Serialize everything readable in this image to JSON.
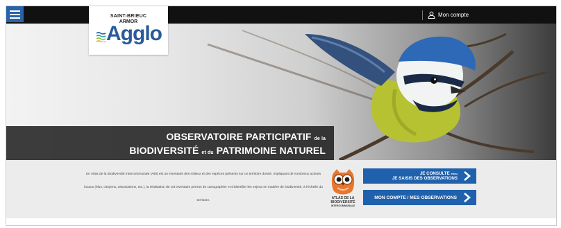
{
  "header": {
    "menu_icon": "hamburger-menu-icon",
    "account_label": "Mon compte",
    "account_icon": "user-icon",
    "background_color": "#111111",
    "menu_color": "#2a62a8"
  },
  "logo": {
    "line1": "SAINT-BRIEUC",
    "line2": "ARMOR",
    "wordmark": "Agglo",
    "tagline": "...",
    "brand_color": "#2b5a9a"
  },
  "hero": {
    "title_part1": "OBSERVATOIRE PARTICIPATIF",
    "title_connector1": "de la",
    "title_part2": "BIODIVERSITÉ",
    "title_connector2": "et du",
    "title_part3": "PATRIMOINE NATUREL",
    "image_subject": "blue tit bird on branch"
  },
  "info": {
    "description": "Un Atlas de la Biodiversité Intercommunale (ABI) est un inventaire des milieux et des espèces présents sur un territoire donné. Impliquant de nombreux acteurs locaux (élus, citoyens, associations, etc.), la réalisation de cet inventaire permet de cartographier et d'identifier les enjeux en matière de biodiversité, à l'échelle du territoire.",
    "atlas_logo_line1": "ATLAS DE LA",
    "atlas_logo_line2": "BIODIVERSITÉ",
    "atlas_logo_line3": "INTERCOMMUNALE",
    "atlas_icon": "owl-icon"
  },
  "buttons": {
    "consult_line1": "JE CONSULTE",
    "consult_connector": "et/ou",
    "consult_line2": "JE SAISIS DES OBSERVATIONS",
    "account_observations": "MON COMPTE / MES OBSERVATIONS",
    "chevron_icon": "chevron-right-icon",
    "button_color": "#1f61ac"
  }
}
